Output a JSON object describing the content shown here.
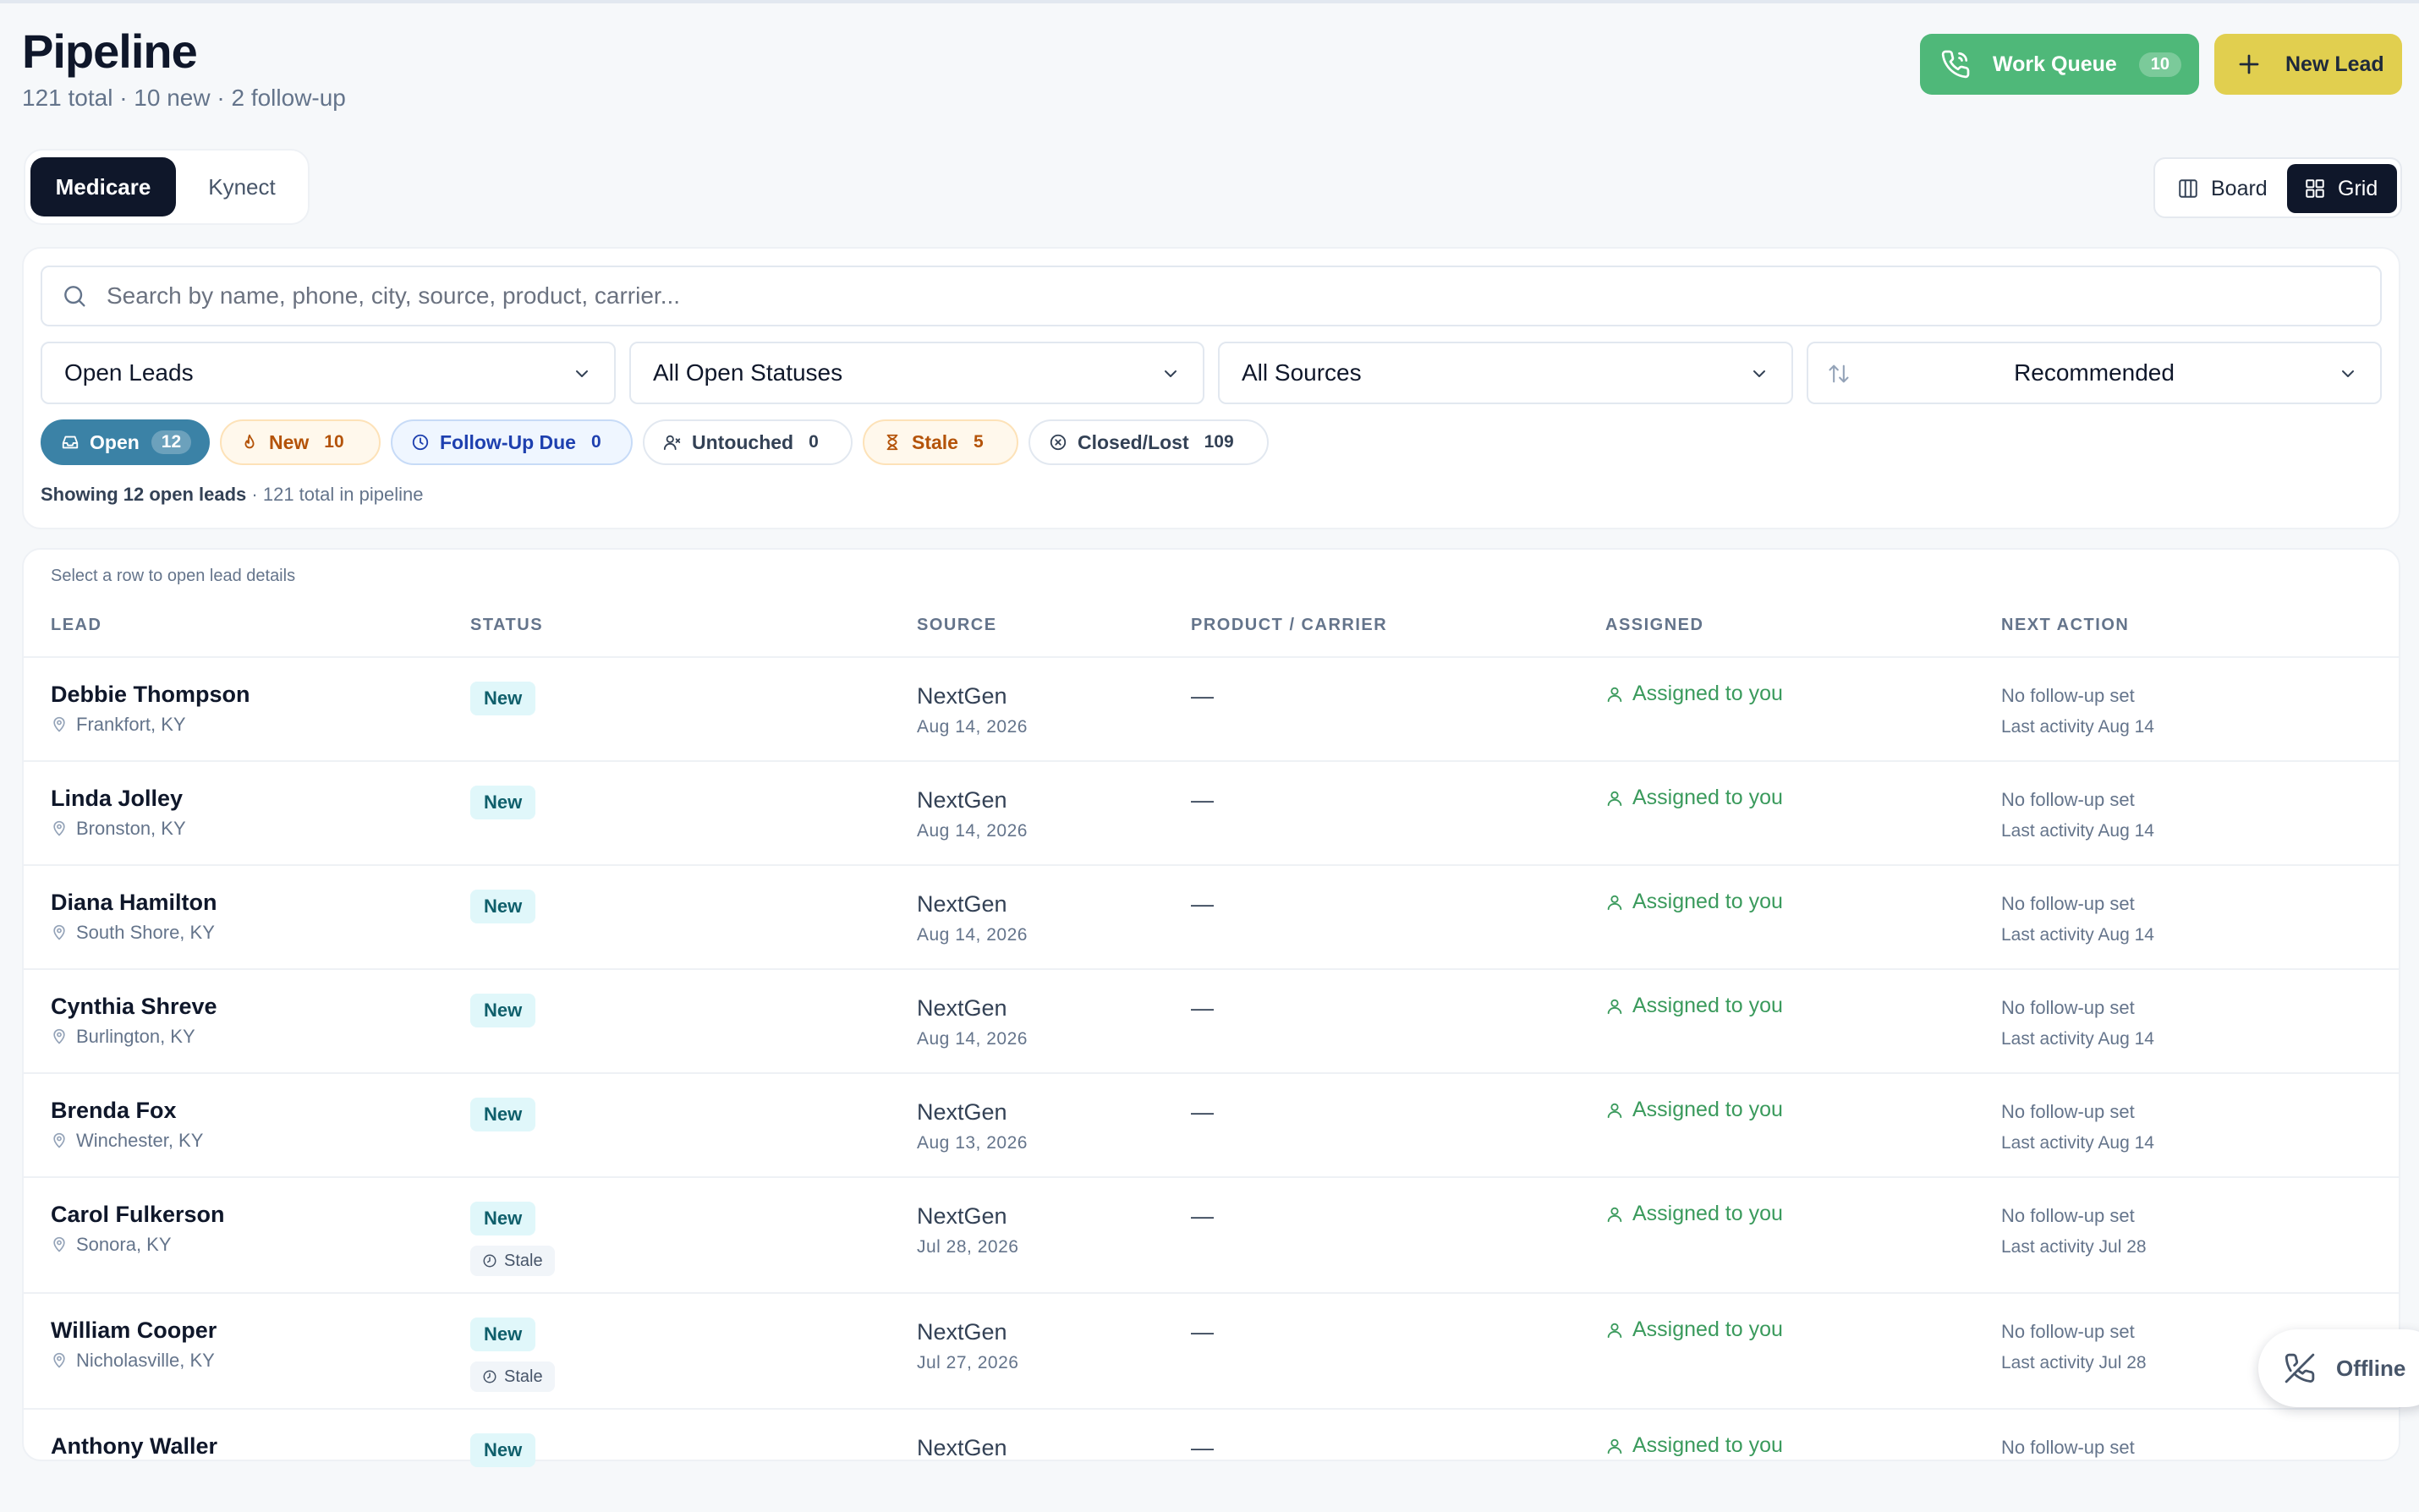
{
  "header": {
    "title": "Pipeline",
    "subtitle": "121 total · 10 new · 2 follow-up",
    "work_queue_label": "Work Queue",
    "work_queue_count": "10",
    "new_lead_label": "New Lead"
  },
  "tabs": [
    {
      "label": "Medicare",
      "active": true
    },
    {
      "label": "Kynect",
      "active": false
    }
  ],
  "view_toggle": {
    "board": "Board",
    "grid": "Grid",
    "selected": "Grid"
  },
  "search": {
    "placeholder": "Search by name, phone, city, source, product, carrier..."
  },
  "filters": {
    "scope": "Open Leads",
    "status": "All Open Statuses",
    "source": "All Sources",
    "sort": "Recommended"
  },
  "chips": [
    {
      "label": "Open",
      "count": "12"
    },
    {
      "label": "New",
      "count": "10"
    },
    {
      "label": "Follow-Up Due",
      "count": "0"
    },
    {
      "label": "Untouched",
      "count": "0"
    },
    {
      "label": "Stale",
      "count": "5"
    },
    {
      "label": "Closed/Lost",
      "count": "109"
    }
  ],
  "summary": {
    "main": "Showing 12 open leads",
    "muted": "· 121 total in pipeline"
  },
  "table": {
    "hint": "Select a row to open lead details",
    "columns": [
      "LEAD",
      "STATUS",
      "SOURCE",
      "PRODUCT / CARRIER",
      "ASSIGNED",
      "NEXT ACTION"
    ],
    "rows": [
      {
        "name": "Debbie Thompson",
        "city": "Frankfort, KY",
        "status": "New",
        "stale": "",
        "source": "NextGen",
        "date": "Aug 14, 2026",
        "product": "—",
        "assigned": "Assigned to you",
        "next": "No follow-up set",
        "activity": "Last activity Aug 14"
      },
      {
        "name": "Linda Jolley",
        "city": "Bronston, KY",
        "status": "New",
        "stale": "",
        "source": "NextGen",
        "date": "Aug 14, 2026",
        "product": "—",
        "assigned": "Assigned to you",
        "next": "No follow-up set",
        "activity": "Last activity Aug 14"
      },
      {
        "name": "Diana Hamilton",
        "city": "South Shore, KY",
        "status": "New",
        "stale": "",
        "source": "NextGen",
        "date": "Aug 14, 2026",
        "product": "—",
        "assigned": "Assigned to you",
        "next": "No follow-up set",
        "activity": "Last activity Aug 14"
      },
      {
        "name": "Cynthia Shreve",
        "city": "Burlington, KY",
        "status": "New",
        "stale": "",
        "source": "NextGen",
        "date": "Aug 14, 2026",
        "product": "—",
        "assigned": "Assigned to you",
        "next": "No follow-up set",
        "activity": "Last activity Aug 14"
      },
      {
        "name": "Brenda Fox",
        "city": "Winchester, KY",
        "status": "New",
        "stale": "",
        "source": "NextGen",
        "date": "Aug 13, 2026",
        "product": "—",
        "assigned": "Assigned to you",
        "next": "No follow-up set",
        "activity": "Last activity Aug 14"
      },
      {
        "name": "Carol Fulkerson",
        "city": "Sonora, KY",
        "status": "New",
        "stale": "Stale",
        "source": "NextGen",
        "date": "Jul 28, 2026",
        "product": "—",
        "assigned": "Assigned to you",
        "next": "No follow-up set",
        "activity": "Last activity Jul 28"
      },
      {
        "name": "William Cooper",
        "city": "Nicholasville, KY",
        "status": "New",
        "stale": "Stale",
        "source": "NextGen",
        "date": "Jul 27, 2026",
        "product": "—",
        "assigned": "Assigned to you",
        "next": "No follow-up set",
        "activity": "Last activity Jul 28"
      },
      {
        "name": "Anthony Waller",
        "city": "",
        "status": "New",
        "stale": "",
        "source": "NextGen",
        "date": "",
        "product": "—",
        "assigned": "Assigned to you",
        "next": "No follow-up set",
        "activity": ""
      }
    ]
  },
  "offline_label": "Offline",
  "colors": {
    "accent_dark": "#0f172a",
    "work_queue_green": "#4fb879",
    "new_lead_yellow": "#e1cf4f",
    "open_chip_blue": "#3b82a6",
    "assigned_green": "#3a9a5c"
  }
}
